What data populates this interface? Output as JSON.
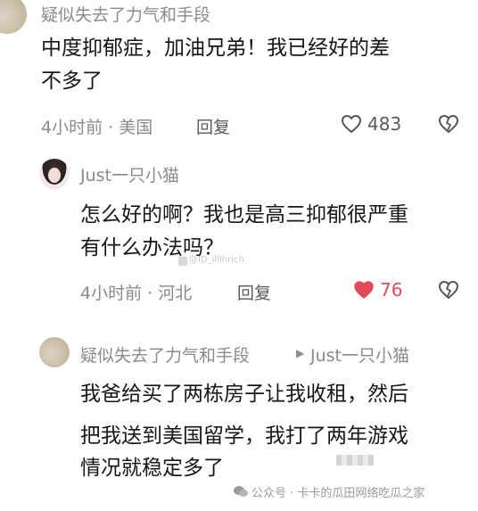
{
  "comments": [
    {
      "username": "疑似失去了力气和手段",
      "lines": [
        "中度抑郁症，加油兄弟！我已经好的差",
        "不多了"
      ],
      "time_location": "4小时前 · 美国",
      "reply_label": "回复",
      "like_count": "483",
      "liked": false
    },
    {
      "username": "Just一只小猫",
      "lines": [
        "怎么好的啊？我也是高三抑郁很严重",
        "有什么办法吗？"
      ],
      "time_location": "4小时前 · 河北",
      "reply_label": "回复",
      "like_count": "76",
      "liked": true
    },
    {
      "username": "疑似失去了力气和手段",
      "reply_to": "Just一只小猫",
      "lines": [
        "我爸给买了两栋房子让我收租，然后",
        "把我送到美国留学，我打了两年游戏",
        "情况就稳定多了"
      ]
    }
  ],
  "watermarks": {
    "mid": "@ID_illlhrich",
    "bottom": "公众号 · 卡卡的瓜田网络吃瓜之家"
  },
  "colors": {
    "like_active": "#e24a5a",
    "meta_gray": "#8a8a8a"
  },
  "icons": {
    "like": "heart-outline-icon",
    "liked": "heart-filled-icon",
    "dislike": "broken-heart-icon",
    "arrow": "play-triangle-icon"
  }
}
